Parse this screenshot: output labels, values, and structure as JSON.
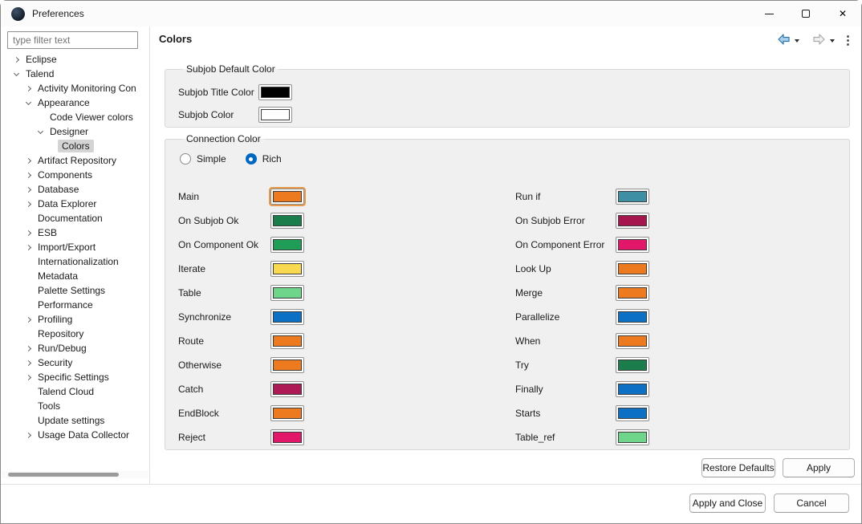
{
  "window": {
    "title": "Preferences"
  },
  "icons": {
    "app": "dark-circle-logo",
    "back": "left-arrow",
    "back_dropdown": "caret-down",
    "forward": "right-arrow",
    "forward_dropdown": "caret-down",
    "view_menu": "vertical-dots",
    "minimize": "dash",
    "maximize": "square",
    "close": "x"
  },
  "sidebar": {
    "filter": {
      "placeholder": "type filter text",
      "value": ""
    },
    "tree": [
      {
        "label": "Eclipse",
        "level": 0,
        "state": "collapsed",
        "selected": false
      },
      {
        "label": "Talend",
        "level": 0,
        "state": "expanded",
        "selected": false
      },
      {
        "label": "Activity Monitoring Con",
        "level": 1,
        "state": "collapsed",
        "selected": false
      },
      {
        "label": "Appearance",
        "level": 1,
        "state": "expanded",
        "selected": false
      },
      {
        "label": "Code Viewer colors",
        "level": 2,
        "state": "none",
        "selected": false
      },
      {
        "label": "Designer",
        "level": 2,
        "state": "expanded",
        "selected": false
      },
      {
        "label": "Colors",
        "level": 3,
        "state": "none",
        "selected": true
      },
      {
        "label": "Artifact Repository",
        "level": 1,
        "state": "collapsed",
        "selected": false
      },
      {
        "label": "Components",
        "level": 1,
        "state": "collapsed",
        "selected": false
      },
      {
        "label": "Database",
        "level": 1,
        "state": "collapsed",
        "selected": false
      },
      {
        "label": "Data Explorer",
        "level": 1,
        "state": "collapsed",
        "selected": false
      },
      {
        "label": "Documentation",
        "level": 1,
        "state": "none",
        "selected": false
      },
      {
        "label": "ESB",
        "level": 1,
        "state": "collapsed",
        "selected": false
      },
      {
        "label": "Import/Export",
        "level": 1,
        "state": "collapsed",
        "selected": false
      },
      {
        "label": "Internationalization",
        "level": 1,
        "state": "none",
        "selected": false
      },
      {
        "label": "Metadata",
        "level": 1,
        "state": "none",
        "selected": false
      },
      {
        "label": "Palette Settings",
        "level": 1,
        "state": "none",
        "selected": false
      },
      {
        "label": "Performance",
        "level": 1,
        "state": "none",
        "selected": false
      },
      {
        "label": "Profiling",
        "level": 1,
        "state": "collapsed",
        "selected": false
      },
      {
        "label": "Repository",
        "level": 1,
        "state": "none",
        "selected": false
      },
      {
        "label": "Run/Debug",
        "level": 1,
        "state": "collapsed",
        "selected": false
      },
      {
        "label": "Security",
        "level": 1,
        "state": "collapsed",
        "selected": false
      },
      {
        "label": "Specific Settings",
        "level": 1,
        "state": "collapsed",
        "selected": false
      },
      {
        "label": "Talend Cloud",
        "level": 1,
        "state": "none",
        "selected": false
      },
      {
        "label": "Tools",
        "level": 1,
        "state": "none",
        "selected": false
      },
      {
        "label": "Update settings",
        "level": 1,
        "state": "none",
        "selected": false
      },
      {
        "label": "Usage Data Collector",
        "level": 1,
        "state": "collapsed",
        "selected": false
      }
    ]
  },
  "main": {
    "title": "Colors",
    "subjob_group": {
      "legend": "Subjob Default Color",
      "rows": [
        {
          "label": "Subjob Title Color",
          "color": "#000000"
        },
        {
          "label": "Subjob Color",
          "color": "#FFFFFF"
        }
      ]
    },
    "connection_group": {
      "legend": "Connection Color",
      "radios": [
        {
          "label": "Simple",
          "selected": false
        },
        {
          "label": "Rich",
          "selected": true
        }
      ],
      "left_column": [
        {
          "label": "Main",
          "color": "#ED7A1E",
          "focused": true
        },
        {
          "label": "On Subjob Ok",
          "color": "#1B7D4B"
        },
        {
          "label": "On Component Ok",
          "color": "#1F9D57"
        },
        {
          "label": "Iterate",
          "color": "#F9D94F"
        },
        {
          "label": "Table",
          "color": "#6FD58B"
        },
        {
          "label": "Synchronize",
          "color": "#0C71C4"
        },
        {
          "label": "Route",
          "color": "#ED7A1E"
        },
        {
          "label": "Otherwise",
          "color": "#ED7A1E"
        },
        {
          "label": "Catch",
          "color": "#AE1A56"
        },
        {
          "label": "EndBlock",
          "color": "#ED7A1E"
        },
        {
          "label": "Reject",
          "color": "#E2176A"
        }
      ],
      "right_column": [
        {
          "label": "Run if",
          "color": "#3F8FA4"
        },
        {
          "label": "On Subjob Error",
          "color": "#A5164F"
        },
        {
          "label": "On Component Error",
          "color": "#E2176A"
        },
        {
          "label": "Look Up",
          "color": "#ED7A1E"
        },
        {
          "label": "Merge",
          "color": "#ED7A1E"
        },
        {
          "label": "Parallelize",
          "color": "#0C71C4"
        },
        {
          "label": "When",
          "color": "#ED7A1E"
        },
        {
          "label": "Try",
          "color": "#1B7D4B"
        },
        {
          "label": "Finally",
          "color": "#0C71C4"
        },
        {
          "label": "Starts",
          "color": "#0C71C4"
        },
        {
          "label": "Table_ref",
          "color": "#6FD58B"
        }
      ]
    },
    "buttons": {
      "restore": "Restore Defaults",
      "apply": "Apply"
    }
  },
  "footer": {
    "apply_and_close": "Apply and Close",
    "cancel": "Cancel"
  }
}
